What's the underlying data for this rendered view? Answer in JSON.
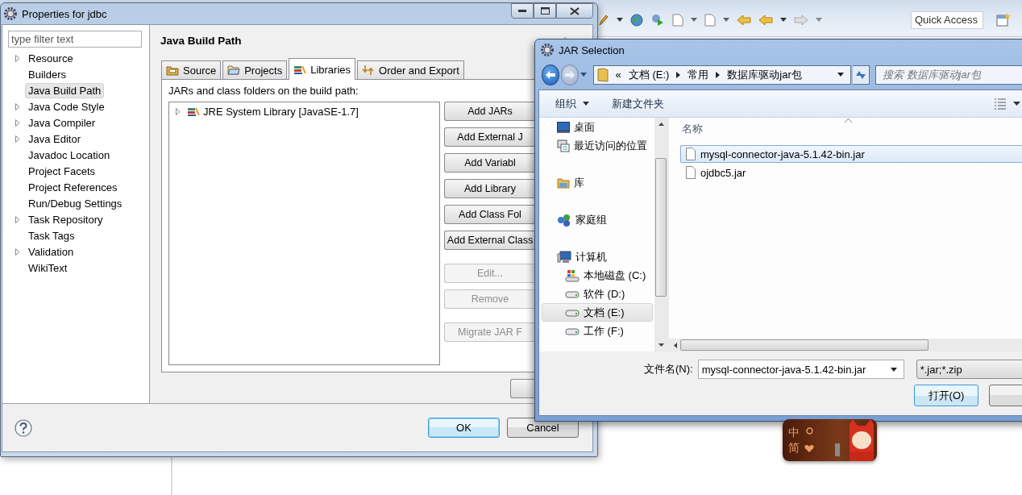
{
  "ide": {
    "quick_access": {
      "placeholder": "Quick Access"
    }
  },
  "properties_window": {
    "title": "Properties for jdbc",
    "filter": {
      "placeholder": "type filter text"
    },
    "nav_items": [
      {
        "label": "Resource",
        "expandable": true,
        "selected": false
      },
      {
        "label": "Builders",
        "expandable": false,
        "selected": false
      },
      {
        "label": "Java Build Path",
        "expandable": false,
        "selected": true
      },
      {
        "label": "Java Code Style",
        "expandable": true,
        "selected": false
      },
      {
        "label": "Java Compiler",
        "expandable": true,
        "selected": false
      },
      {
        "label": "Java Editor",
        "expandable": true,
        "selected": false
      },
      {
        "label": "Javadoc Location",
        "expandable": false,
        "selected": false
      },
      {
        "label": "Project Facets",
        "expandable": false,
        "selected": false
      },
      {
        "label": "Project References",
        "expandable": false,
        "selected": false
      },
      {
        "label": "Run/Debug Settings",
        "expandable": false,
        "selected": false
      },
      {
        "label": "Task Repository",
        "expandable": true,
        "selected": false
      },
      {
        "label": "Task Tags",
        "expandable": false,
        "selected": false
      },
      {
        "label": "Validation",
        "expandable": true,
        "selected": false
      },
      {
        "label": "WikiText",
        "expandable": false,
        "selected": false
      }
    ],
    "page_title": "Java Build Path",
    "tabs": [
      {
        "label": "Source",
        "kind": "source",
        "selected": false
      },
      {
        "label": "Projects",
        "kind": "projects",
        "selected": false
      },
      {
        "label": "Libraries",
        "kind": "libraries",
        "selected": true
      },
      {
        "label": "Order and Export",
        "kind": "order",
        "selected": false
      }
    ],
    "libraries_label": "JARs and class folders on the build path:",
    "entries": [
      {
        "label": "JRE System Library [JavaSE-1.7]",
        "expandable": true
      }
    ],
    "button_groups": [
      [
        {
          "label": "Add JARs",
          "disabled": false
        },
        {
          "label": "Add External J",
          "disabled": false
        },
        {
          "label": "Add Variabl",
          "disabled": false
        },
        {
          "label": "Add Library",
          "disabled": false
        },
        {
          "label": "Add Class Fol",
          "disabled": false
        },
        {
          "label": "Add External Class",
          "disabled": false
        }
      ],
      [
        {
          "label": "Edit...",
          "disabled": true
        },
        {
          "label": "Remove",
          "disabled": true
        }
      ],
      [
        {
          "label": "Migrate JAR F",
          "disabled": true
        }
      ]
    ],
    "dialog_buttons": [
      {
        "label": "OK",
        "default": true
      },
      {
        "label": "Cancel",
        "default": false
      }
    ]
  },
  "jar_dialog": {
    "title": "JAR Selection",
    "breadcrumb_prefix": "«",
    "breadcrumb": [
      "文档 (E:)",
      "常用",
      "数据库驱动jar包"
    ],
    "search": {
      "placeholder": "搜索 数据库驱动jar包"
    },
    "toolbar": [
      {
        "label": "组织",
        "menu": true
      },
      {
        "label": "新建文件夹",
        "menu": false
      }
    ],
    "nav_sections": [
      {
        "items": [
          {
            "label": "桌面",
            "kind": "desktop",
            "selected": false
          },
          {
            "label": "最近访问的位置",
            "kind": "recent",
            "selected": false
          }
        ]
      },
      {
        "items": [
          {
            "label": "库",
            "kind": "library",
            "selected": false
          }
        ]
      },
      {
        "items": [
          {
            "label": "家庭组",
            "kind": "homegroup",
            "selected": false
          }
        ]
      },
      {
        "items": [
          {
            "label": "计算机",
            "kind": "computer",
            "selected": false,
            "children": [
              {
                "label": "本地磁盘 (C:)",
                "kind": "system_drive",
                "selected": false
              },
              {
                "label": "软件 (D:)",
                "kind": "drive",
                "selected": false
              },
              {
                "label": "文档 (E:)",
                "kind": "drive",
                "selected": true
              },
              {
                "label": "工作 (F:)",
                "kind": "drive",
                "selected": false
              }
            ]
          }
        ]
      }
    ],
    "column": "名称",
    "files": [
      {
        "name": "mysql-connector-java-5.1.42-bin.jar",
        "selected": true
      },
      {
        "name": "ojdbc5.jar",
        "selected": false
      }
    ],
    "filename_label": "文件名(N):",
    "filename": "mysql-connector-java-5.1.42-bin.jar",
    "filter": "*.jar;*.zip",
    "open_button": "打开(O)"
  },
  "ime_widget": {
    "texts": [
      "中",
      "简"
    ]
  }
}
